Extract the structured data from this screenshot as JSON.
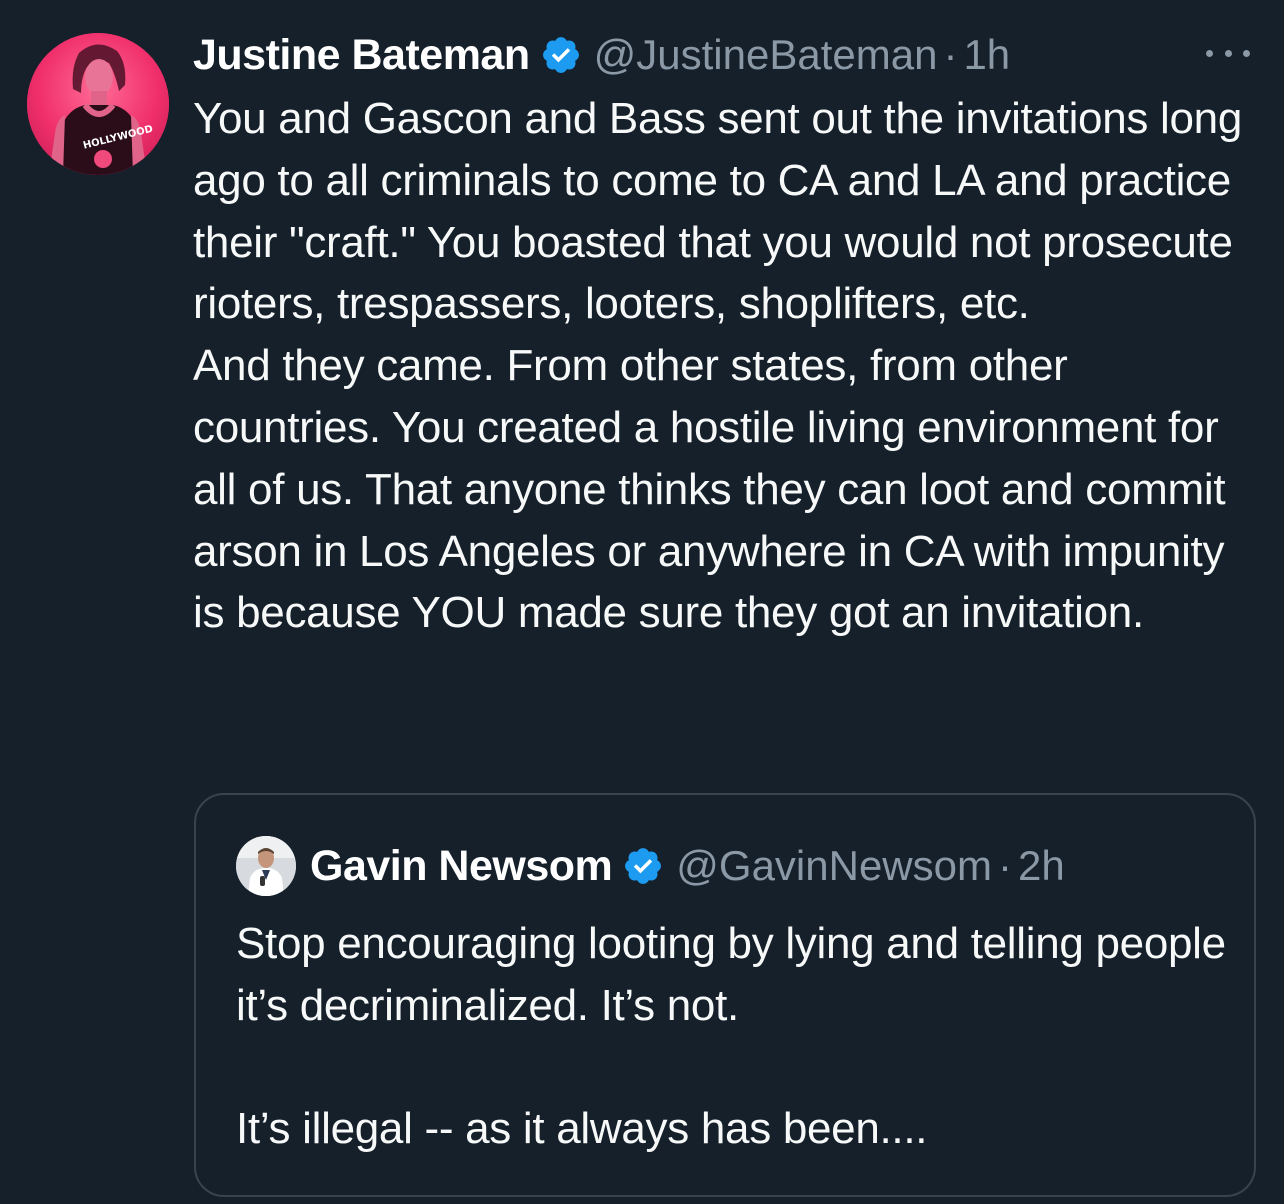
{
  "tweet": {
    "author_name": "Justine Bateman",
    "handle": "@JustineBateman",
    "separator": "·",
    "time": "1h",
    "avatar_text": "HOLLYWOOD",
    "paragraphs": [
      "You and Gascon and Bass sent out the invitations long ago to all criminals to come to CA and LA and practice their \"craft.\"  You boasted that you would not prosecute rioters, trespassers, looters, shoplifters, etc.",
      "And they came. From other states, from other countries. You created a hostile living environment for all of us. That anyone thinks they can loot and commit arson in Los Angeles or anywhere in CA with impunity is because YOU made sure they got an invitation."
    ]
  },
  "quoted": {
    "author_name": "Gavin Newsom",
    "handle": "@GavinNewsom",
    "separator": "·",
    "time": "2h",
    "paragraphs": [
      "Stop encouraging looting by lying and telling people it’s decriminalized. It’s not.",
      "It’s illegal -- as it always has been...."
    ]
  },
  "icons": {
    "verified": "verified-badge-icon",
    "more": "more-options-icon"
  },
  "colors": {
    "background": "#15202b",
    "verified_blue": "#1d9bf0",
    "secondary_text": "#8b98a5",
    "border": "#38444d"
  }
}
